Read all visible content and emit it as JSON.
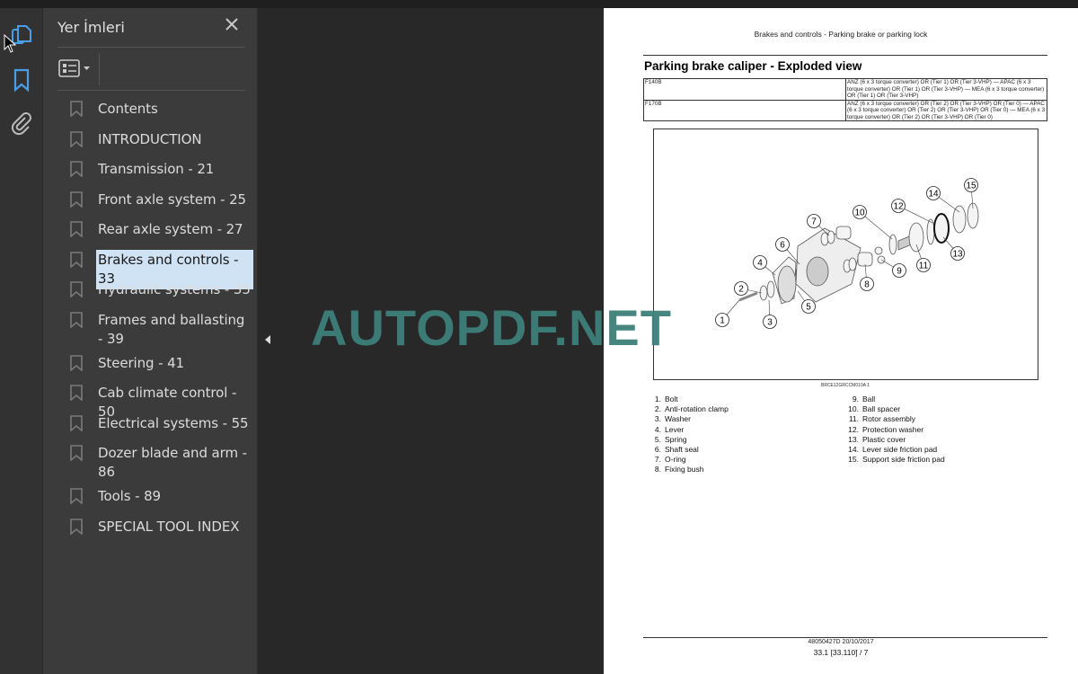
{
  "panel": {
    "title": "Yer İmleri"
  },
  "bookmarks": [
    {
      "label": "Contents",
      "selected": false
    },
    {
      "label": "INTRODUCTION",
      "selected": false
    },
    {
      "label": "Transmission - 21",
      "selected": false
    },
    {
      "label": "Front axle system - 25",
      "selected": false
    },
    {
      "label": "Rear axle system - 27",
      "selected": false
    },
    {
      "label": "Brakes and controls - 33",
      "selected": true
    },
    {
      "label": "Hydraulic systems - 35",
      "selected": false
    },
    {
      "label": "Frames and ballasting - 39",
      "selected": false
    },
    {
      "label": "Steering - 41",
      "selected": false
    },
    {
      "label": "Cab climate control - 50",
      "selected": false
    },
    {
      "label": "Electrical systems - 55",
      "selected": false
    },
    {
      "label": "Dozer blade and arm - 86",
      "selected": false
    },
    {
      "label": "Tools - 89",
      "selected": false
    },
    {
      "label": "SPECIAL TOOL INDEX",
      "selected": false
    }
  ],
  "toolbar": {
    "icons": [
      "pages-icon",
      "bookmark-icon",
      "attachment-icon"
    ],
    "accent": "#4a9ee8"
  },
  "document": {
    "header": "Brakes and controls - Parking brake or parking lock",
    "title": "Parking brake caliper - Exploded view",
    "table": [
      [
        "F140B",
        "ANZ (6 x 3 torque converter) OR (Tier 1) OR (Tier 3-VHP) — APAC (6 x 3 torque converter) OR (Tier 1) OR (Tier 3-VHP) — MEA (6 x 3 torque converter) OR (Tier 1) OR (Tier 3-VHP)"
      ],
      [
        "F170B",
        "ANZ (6 x 3 torque converter) OR (Tier 2) OR (Tier 3-VHP) OR (Tier 0) — APAC (6 x 3 torque converter) OR (Tier 2) OR (Tier 3-VHP) OR (Tier 0) — MEA (6 x 3 torque converter) OR (Tier 2) OR (Tier 3-VHP) OR (Tier 0)"
      ]
    ],
    "callouts": [
      "1",
      "2",
      "3",
      "4",
      "5",
      "6",
      "7",
      "8",
      "9",
      "10",
      "11",
      "12",
      "13",
      "14",
      "15"
    ],
    "figure_id": "BRCE12GRCCM010A    1",
    "legend_left": [
      [
        "1.",
        "Bolt"
      ],
      [
        "2.",
        "Anti-rotation clamp"
      ],
      [
        "3.",
        "Washer"
      ],
      [
        "4.",
        "Lever"
      ],
      [
        "5.",
        "Spring"
      ],
      [
        "6.",
        "Shaft seal"
      ],
      [
        "7.",
        "O-ring"
      ],
      [
        "8.",
        "Fixing bush"
      ]
    ],
    "legend_right": [
      [
        "9.",
        "Ball"
      ],
      [
        "10.",
        "Ball spacer"
      ],
      [
        "11.",
        "Rotor assembly"
      ],
      [
        "12.",
        "Protection washer"
      ],
      [
        "13.",
        "Plastic cover"
      ],
      [
        "14.",
        "Lever side friction pad"
      ],
      [
        "15.",
        "Support side friction pad"
      ]
    ],
    "footer_code": "48050427D 20/10/2017",
    "footer_page": "33.1 [33.110] / 7"
  },
  "watermark": "AUTOPDF.NET",
  "watermark_color": "#3d7f7a"
}
